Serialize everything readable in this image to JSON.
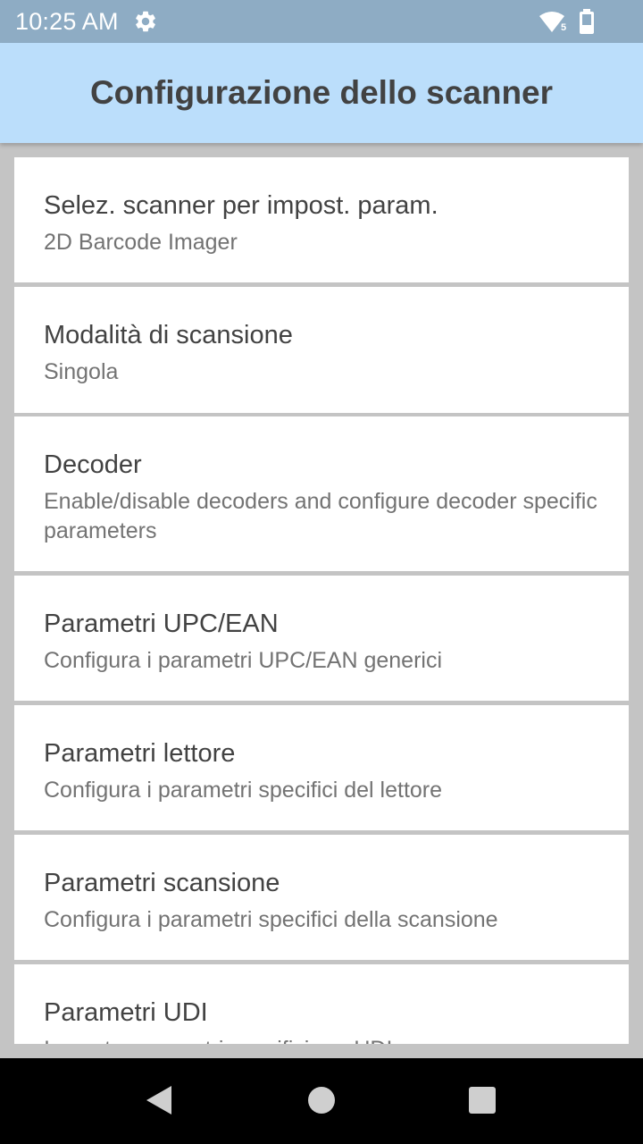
{
  "status_bar": {
    "time": "10:25 AM",
    "icons": [
      "gear-icon",
      "wifi-icon",
      "battery-icon"
    ],
    "background": "#8eacc4"
  },
  "app_bar": {
    "title": "Configurazione dello scanner",
    "background": "#bbdefb"
  },
  "preferences": [
    {
      "title": "Selez. scanner per impost. param.",
      "summary": "2D Barcode Imager"
    },
    {
      "title": "Modalità di scansione",
      "summary": "Singola"
    },
    {
      "title": "Decoder",
      "summary": "Enable/disable decoders and configure decoder specific parameters"
    },
    {
      "title": "Parametri UPC/EAN",
      "summary": "Configura i parametri UPC/EAN generici"
    },
    {
      "title": "Parametri lettore",
      "summary": "Configura i parametri specifici del lettore"
    },
    {
      "title": "Parametri scansione",
      "summary": "Configura i parametri specifici della scansione"
    },
    {
      "title": "Parametri UDI",
      "summary": "Imposta parametri specifici per UDI"
    }
  ],
  "nav_bar": {
    "icons": [
      "back-icon",
      "home-icon",
      "recents-icon"
    ]
  }
}
